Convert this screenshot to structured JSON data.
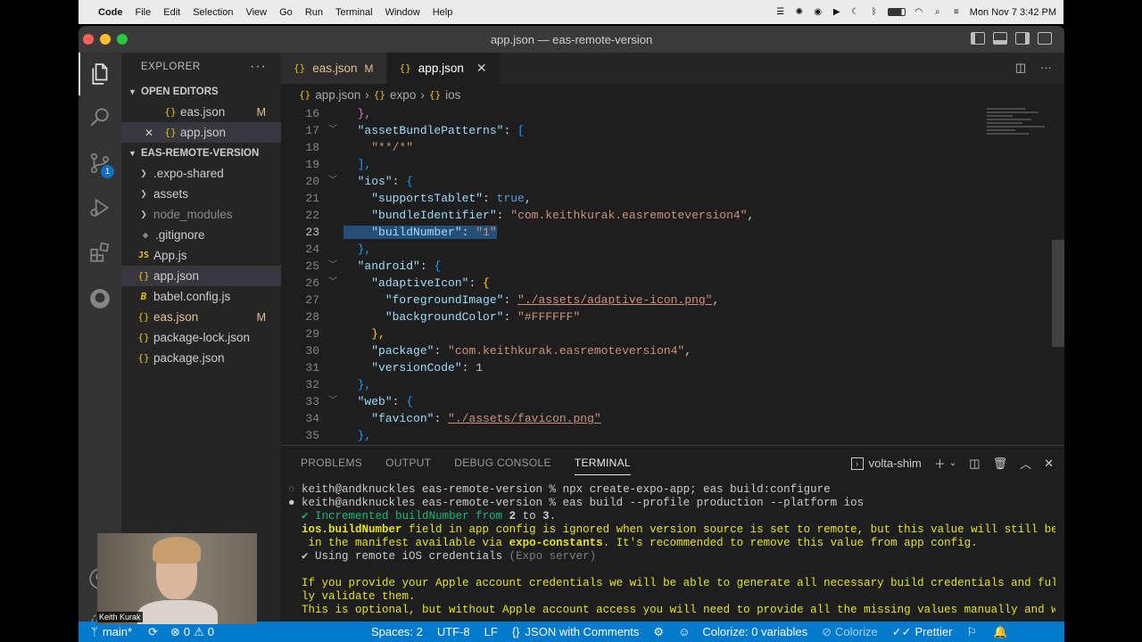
{
  "menubar": {
    "app": "Code",
    "items": [
      "File",
      "Edit",
      "Selection",
      "View",
      "Go",
      "Run",
      "Terminal",
      "Window",
      "Help"
    ],
    "clock": "Mon Nov 7  3:42 PM"
  },
  "window": {
    "title": "app.json — eas-remote-version"
  },
  "activity": {
    "scm_badge": "1"
  },
  "sidebar": {
    "title": "EXPLORER",
    "more": "···",
    "open_editors_label": "OPEN EDITORS",
    "open_editors": [
      {
        "name": "eas.json",
        "status": "M"
      },
      {
        "name": "app.json",
        "close": "✕"
      }
    ],
    "project_label": "EAS-REMOTE-VERSION",
    "files": [
      {
        "name": ".expo-shared",
        "kind": "folder"
      },
      {
        "name": "assets",
        "kind": "folder"
      },
      {
        "name": "node_modules",
        "kind": "folder"
      },
      {
        "name": ".gitignore",
        "kind": "file"
      },
      {
        "name": "App.js",
        "kind": "js",
        "icon": "JS"
      },
      {
        "name": "app.json",
        "kind": "json"
      },
      {
        "name": "babel.config.js",
        "kind": "babel"
      },
      {
        "name": "eas.json",
        "kind": "json",
        "status": "M"
      },
      {
        "name": "package-lock.json",
        "kind": "json"
      },
      {
        "name": "package.json",
        "kind": "json"
      }
    ]
  },
  "tabs": [
    {
      "label": "eas.json",
      "status": "M"
    },
    {
      "label": "app.json",
      "close": "✕"
    }
  ],
  "breadcrumb": [
    "app.json",
    "expo",
    "ios"
  ],
  "code_lines": [
    "16",
    "17",
    "18",
    "19",
    "20",
    "21",
    "22",
    "23",
    "24",
    "25",
    "26",
    "27",
    "28",
    "29",
    "30",
    "31",
    "32",
    "33",
    "34",
    "35"
  ],
  "code": {
    "l16": "},",
    "l17_key": "\"assetBundlePatterns\"",
    "l18_str": "\"**/*\"",
    "l19": "],",
    "l20_key": "\"ios\"",
    "l21_key": "\"supportsTablet\"",
    "l21_val": "true",
    "l22_key": "\"bundleIdentifier\"",
    "l22_val": "\"com.keithkurak.easremoteversion4\"",
    "l23_key": "\"buildNumber\"",
    "l23_val": "\"1\"",
    "l24": "},",
    "l25_key": "\"android\"",
    "l26_key": "\"adaptiveIcon\"",
    "l27_key": "\"foregroundImage\"",
    "l27_val": "\"./assets/adaptive-icon.png\"",
    "l28_key": "\"backgroundColor\"",
    "l28_val": "\"#FFFFFF\"",
    "l29": "},",
    "l30_key": "\"package\"",
    "l30_val": "\"com.keithkurak.easremoteversion4\"",
    "l31_key": "\"versionCode\"",
    "l31_val": "1",
    "l32": "},",
    "l33_key": "\"web\"",
    "l34_key": "\"favicon\"",
    "l34_val": "\"./assets/favicon.png\"",
    "l35": "},"
  },
  "panel": {
    "tabs": [
      "PROBLEMS",
      "OUTPUT",
      "DEBUG CONSOLE",
      "TERMINAL"
    ],
    "shell": "volta-shim",
    "terminal": {
      "t1": "keith@andknuckles eas-remote-version % npx create-expo-app; eas build:configure",
      "t2": "keith@andknuckles eas-remote-version % eas build --profile production --platform ios",
      "t3a": "✔ Incremented buildNumber from ",
      "t3b": "2",
      "t3c": " to ",
      "t3d": "3",
      "t3e": ".",
      "t4a": "ios.buildNumber",
      "t4b": " field in app config is ignored when version source is set to remote, but this value will still be",
      "t5a": " in the manifest available via ",
      "t5b": "expo-constants",
      "t5c": ". It's recommended to remove this value from app config.",
      "t6a": "✔ Using remote iOS credentials ",
      "t6b": "(Expo server)",
      "t7": "If you provide your Apple account credentials we will be able to generate all necessary build credentials and ful",
      "t8": "ly validate them.",
      "t9": "This is optional, but without Apple account access you will need to provide all the missing values manually and w"
    }
  },
  "status": {
    "branch": "main*",
    "errors": "0",
    "warnings": "0",
    "spaces": "Spaces: 2",
    "encoding": "UTF-8",
    "eol": "LF",
    "language": "JSON with Comments",
    "colorize_vars": "Colorize: 0 variables",
    "colorize": "Colorize",
    "prettier": "Prettier"
  },
  "webcam": {
    "name": "Keith Kurak"
  },
  "colors": {
    "accent": "#007acc",
    "modified": "#e2c08d",
    "selection": "#264f78"
  }
}
